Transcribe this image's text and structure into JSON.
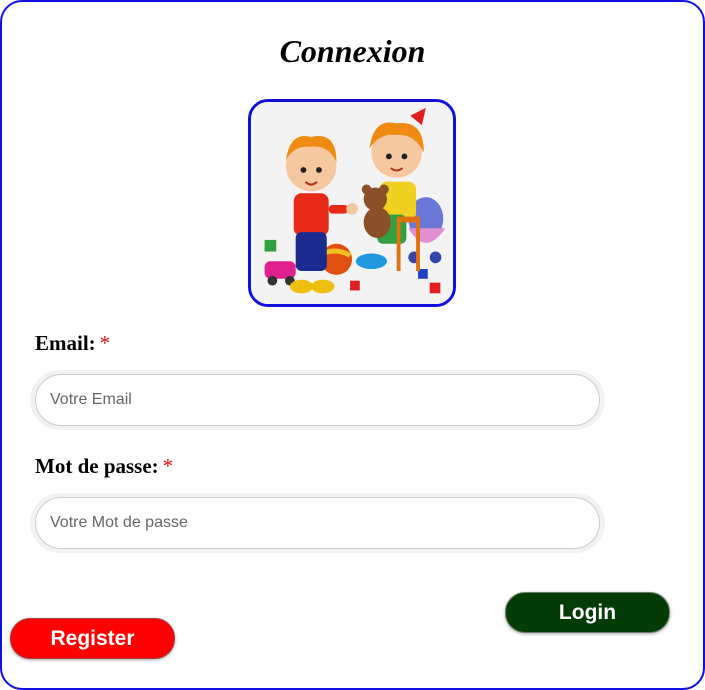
{
  "page": {
    "title": "Connexion"
  },
  "form": {
    "email": {
      "label": "Email:",
      "required_mark": "*",
      "placeholder": "Votre Email",
      "value": ""
    },
    "password": {
      "label": "Mot de passe:",
      "required_mark": "*",
      "placeholder": "Votre Mot de passe",
      "value": ""
    }
  },
  "buttons": {
    "login_label": "Login",
    "register_label": "Register"
  },
  "colors": {
    "frame_border": "#1010e0",
    "login_bg": "#053c05",
    "register_bg": "#ff0000",
    "required": "#d01010"
  },
  "illustration": {
    "icon": "children-playing-illustration"
  }
}
